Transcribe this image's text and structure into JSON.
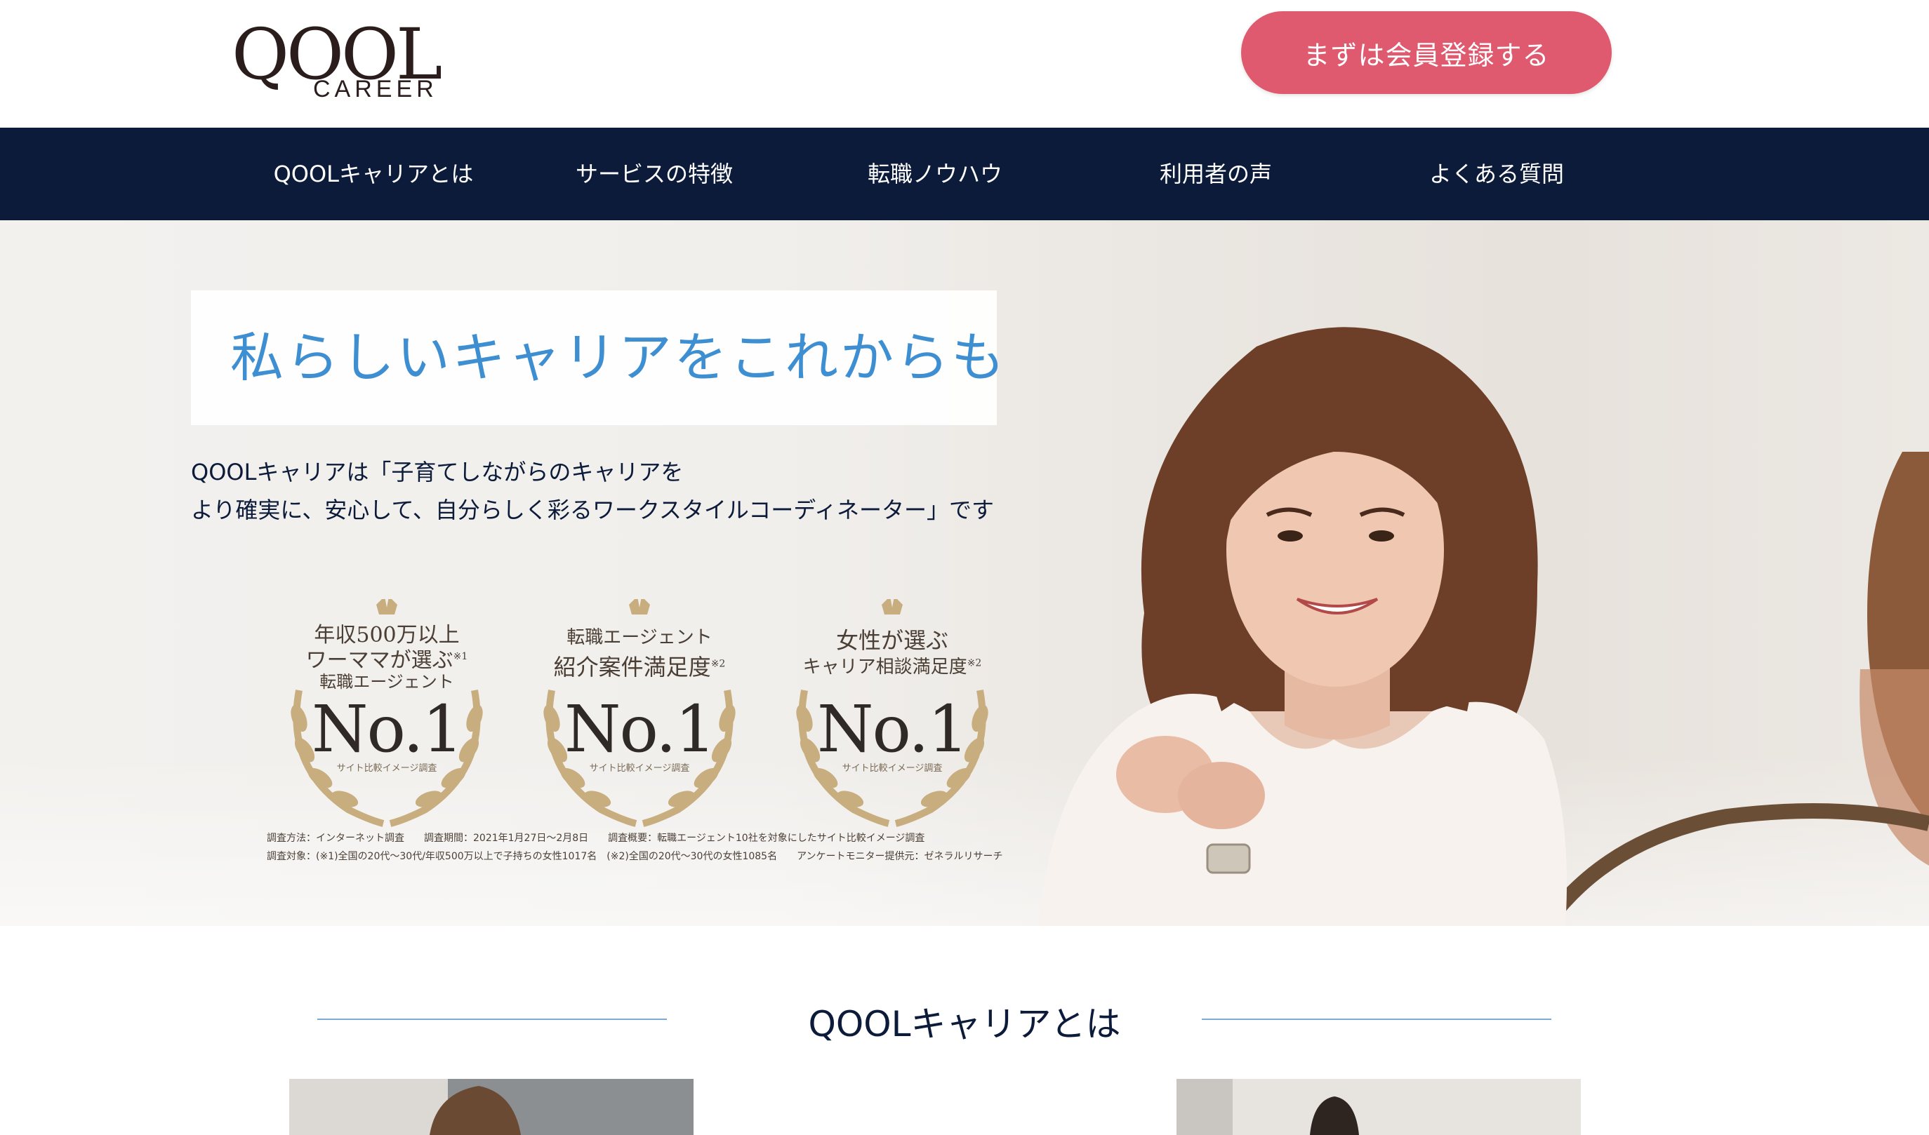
{
  "header": {
    "logo_main": "QOOL",
    "logo_sub": "CAREER",
    "cta_label": "まずは会員登録する"
  },
  "nav": {
    "items": [
      "QOOLキャリアとは",
      "サービスの特徴",
      "転職ノウハウ",
      "利用者の声",
      "よくある質問"
    ]
  },
  "hero": {
    "headline": "私らしいキャリアをこれからも",
    "intro_line1": "QOOLキャリアは「子育てしながらのキャリアを",
    "intro_line2": "より確実に、安心して、自分らしく彩るワークスタイルコーディネーター」です",
    "awards": [
      {
        "line1": "年収500万以上",
        "line2": "ワーママが選ぶ",
        "note": "※1",
        "line3": "転職エージェント",
        "rank": "No.1",
        "sub": "サイト比較イメージ調査"
      },
      {
        "line1": "転職エージェント",
        "line2": "紹介案件満足度",
        "note": "※2",
        "line3": "",
        "rank": "No.1",
        "sub": "サイト比較イメージ調査"
      },
      {
        "line1": "女性が選ぶ",
        "line2": "キャリア相談満足度",
        "note": "※2",
        "line3": "",
        "rank": "No.1",
        "sub": "サイト比較イメージ調査"
      }
    ],
    "survey_line1": "調査方法：インターネット調査　　調査期間：2021年1月27日〜2月8日　　調査概要：転職エージェント10社を対象にしたサイト比較イメージ調査",
    "survey_line2": "調査対象：(※1)全国の20代〜30代/年収500万以上で子持ちの女性1017名　(※2)全国の20代〜30代の女性1085名　　アンケートモニター提供元：ゼネラルリサーチ"
  },
  "section": {
    "title": "QOOLキャリアとは"
  },
  "colors": {
    "navy": "#0c1b3a",
    "cta": "#e05a6f",
    "headline_blue": "#3e8fd2",
    "gold": "#c8ad7f"
  }
}
